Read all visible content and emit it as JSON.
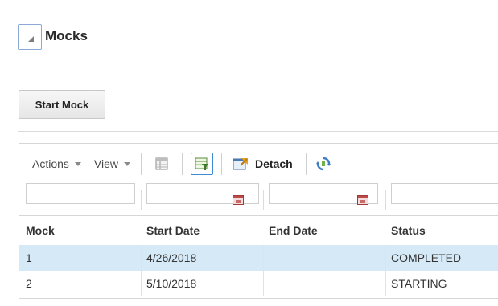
{
  "section": {
    "title": "Mocks",
    "disclosure_icon": "collapse-triangle-icon"
  },
  "start_mock_button": "Start Mock",
  "toolbar": {
    "actions_label": "Actions",
    "view_label": "View",
    "icons": [
      "freeze-icon",
      "query-by-example-icon",
      "detach-icon",
      "refresh-icon"
    ],
    "detach_label": "Detach"
  },
  "filters": {
    "mock": "",
    "start_date": "",
    "end_date": "",
    "status": ""
  },
  "table": {
    "columns": [
      "Mock",
      "Start Date",
      "End Date",
      "Status"
    ],
    "rows": [
      {
        "mock": "1",
        "start_date": "4/26/2018",
        "end_date": "",
        "status": "COMPLETED",
        "selected": true
      },
      {
        "mock": "2",
        "start_date": "5/10/2018",
        "end_date": "",
        "status": "STARTING",
        "selected": false
      }
    ]
  },
  "colors": {
    "selected_row": "#d5e9f7",
    "focus_border": "#3d8bd4"
  }
}
